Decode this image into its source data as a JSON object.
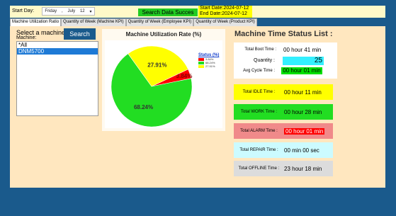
{
  "topbar": {
    "start_day_label": "Start Day:",
    "day_name": "Friday",
    "month": "July",
    "day": "12",
    "search_status": "Search Data Succes",
    "start_date": "Start Date:2024-07-12",
    "end_date": "End Date:2024-07-12"
  },
  "tabs": [
    "Machine Utilization Ratio",
    "Quantity of Week (Machine KPI)",
    "Quantity of Week (Employee KPI)",
    "Quantity of Week (Product KPI)"
  ],
  "machine": {
    "title": "Select a machine",
    "sub": "Machine:",
    "search_label": "Search",
    "items": [
      "*All",
      "DNM5700"
    ]
  },
  "chart_data": {
    "type": "pie",
    "title": "Machine Utilization Rate (%)",
    "legend_title": "Status (%)",
    "legend_position": "top-right",
    "slices": [
      {
        "label": "3.84%",
        "value": 3.84,
        "color": "#ff0000"
      },
      {
        "label": "68.24%",
        "value": 68.24,
        "color": "#22dd22"
      },
      {
        "label": "27.91%",
        "value": 27.91,
        "color": "#ffff00"
      }
    ]
  },
  "status": {
    "title": "Machine Time Status List :",
    "total_boot_label": "Total Boot Time :",
    "total_boot_value": "00 hour 41 min",
    "quantity_label": "Quantity :",
    "quantity_value": "25",
    "avg_cycle_label": "Avg Cycle Time :",
    "avg_cycle_value": "00 hour 01 min",
    "idle_label": "Total IDLE Time :",
    "idle_value": "00 hour 11 min",
    "work_label": "Total WORK Time :",
    "work_value": "00 hour 28 min",
    "alarm_label": "Total ALARM Time :",
    "alarm_value": "00 hour 01 min",
    "repair_label": "Total REPAIR Time :",
    "repair_value": "00 min  00 sec",
    "offline_label": "Total OFFLINE Time :",
    "offline_value": "23 hour 18 min"
  }
}
